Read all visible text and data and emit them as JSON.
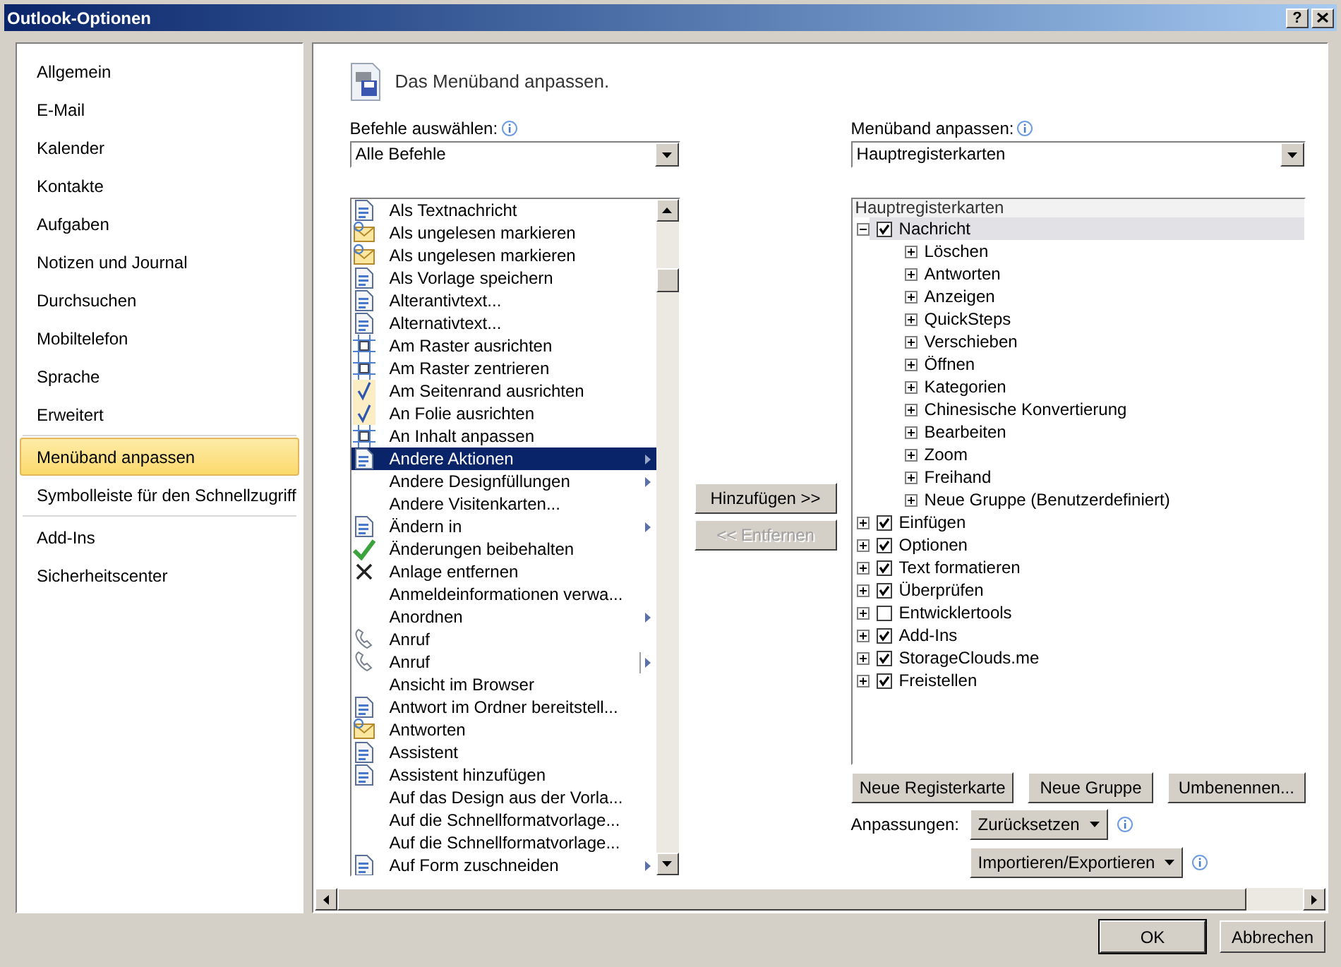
{
  "window": {
    "title": "Outlook-Optionen",
    "help_button": "?"
  },
  "sidebar": {
    "sections": [
      {
        "items": [
          {
            "label": "Allgemein",
            "selected": false
          },
          {
            "label": "E-Mail",
            "selected": false
          },
          {
            "label": "Kalender",
            "selected": false
          },
          {
            "label": "Kontakte",
            "selected": false
          },
          {
            "label": "Aufgaben",
            "selected": false
          },
          {
            "label": "Notizen und Journal",
            "selected": false
          },
          {
            "label": "Durchsuchen",
            "selected": false
          },
          {
            "label": "Mobiltelefon",
            "selected": false
          },
          {
            "label": "Sprache",
            "selected": false
          },
          {
            "label": "Erweitert",
            "selected": false
          }
        ]
      },
      {
        "items": [
          {
            "label": "Menüband anpassen",
            "selected": true
          },
          {
            "label": "Symbolleiste für den Schnellzugriff",
            "selected": false
          }
        ]
      },
      {
        "items": [
          {
            "label": "Add-Ins",
            "selected": false
          },
          {
            "label": "Sicherheitscenter",
            "selected": false
          }
        ]
      }
    ]
  },
  "heading": "Das Menüband anpassen.",
  "commands": {
    "label": "Befehle auswählen:",
    "dropdown": "Alle Befehle",
    "items": [
      {
        "label": "Als Textnachricht",
        "kind": "doc",
        "submenu": false,
        "split": false,
        "selected": false
      },
      {
        "label": "Als ungelesen markieren",
        "kind": "mail",
        "submenu": false,
        "split": false,
        "selected": false
      },
      {
        "label": "Als ungelesen markieren",
        "kind": "mail",
        "submenu": false,
        "split": false,
        "selected": false
      },
      {
        "label": "Als Vorlage speichern",
        "kind": "doc",
        "submenu": false,
        "split": false,
        "selected": false
      },
      {
        "label": "Alterantivtext...",
        "kind": "doc",
        "submenu": false,
        "split": false,
        "selected": false
      },
      {
        "label": "Alternativtext...",
        "kind": "doc",
        "submenu": false,
        "split": false,
        "selected": false
      },
      {
        "label": "Am Raster ausrichten",
        "kind": "grid",
        "submenu": false,
        "split": false,
        "selected": false
      },
      {
        "label": "Am Raster zentrieren",
        "kind": "grid",
        "submenu": false,
        "split": false,
        "selected": false
      },
      {
        "label": "Am Seitenrand ausrichten",
        "kind": "tick",
        "submenu": false,
        "split": false,
        "selected": false
      },
      {
        "label": "An Folie ausrichten",
        "kind": "tick",
        "submenu": false,
        "split": false,
        "selected": false
      },
      {
        "label": "An Inhalt anpassen",
        "kind": "grid",
        "submenu": false,
        "split": false,
        "selected": false
      },
      {
        "label": "Andere Aktionen",
        "kind": "doc",
        "submenu": true,
        "split": false,
        "selected": true
      },
      {
        "label": "Andere Designfüllungen",
        "kind": "plain",
        "submenu": true,
        "split": false,
        "selected": false
      },
      {
        "label": "Andere Visitenkarten...",
        "kind": "plain",
        "submenu": false,
        "split": false,
        "selected": false
      },
      {
        "label": "Ändern in",
        "kind": "doc",
        "submenu": true,
        "split": false,
        "selected": false
      },
      {
        "label": "Änderungen beibehalten",
        "kind": "check",
        "submenu": false,
        "split": false,
        "selected": false
      },
      {
        "label": "Anlage entfernen",
        "kind": "cross",
        "submenu": false,
        "split": false,
        "selected": false
      },
      {
        "label": "Anmeldeinformationen verwa...",
        "kind": "plain",
        "submenu": false,
        "split": false,
        "selected": false
      },
      {
        "label": "Anordnen",
        "kind": "plain",
        "submenu": true,
        "split": false,
        "selected": false
      },
      {
        "label": "Anruf",
        "kind": "phone",
        "submenu": false,
        "split": false,
        "selected": false
      },
      {
        "label": "Anruf",
        "kind": "phone",
        "submenu": true,
        "split": true,
        "selected": false
      },
      {
        "label": "Ansicht im Browser",
        "kind": "plain",
        "submenu": false,
        "split": false,
        "selected": false
      },
      {
        "label": "Antwort im Ordner bereitstell...",
        "kind": "doc",
        "submenu": false,
        "split": false,
        "selected": false
      },
      {
        "label": "Antworten",
        "kind": "mail",
        "submenu": false,
        "split": false,
        "selected": false
      },
      {
        "label": "Assistent",
        "kind": "doc",
        "submenu": false,
        "split": false,
        "selected": false
      },
      {
        "label": "Assistent hinzufügen",
        "kind": "doc",
        "submenu": false,
        "split": false,
        "selected": false
      },
      {
        "label": "Auf das Design aus der Vorla...",
        "kind": "plain",
        "submenu": false,
        "split": false,
        "selected": false
      },
      {
        "label": "Auf die Schnellformatvorlage...",
        "kind": "plain",
        "submenu": false,
        "split": false,
        "selected": false
      },
      {
        "label": "Auf die Schnellformatvorlage...",
        "kind": "plain",
        "submenu": false,
        "split": false,
        "selected": false
      },
      {
        "label": "Auf Form zuschneiden",
        "kind": "doc",
        "submenu": true,
        "split": false,
        "selected": false
      }
    ]
  },
  "add_button": {
    "label": "Hinzufügen >>",
    "disabled": false
  },
  "remove_button": {
    "label": "<< Entfernen",
    "disabled": true
  },
  "ribbon": {
    "label": "Menüband anpassen:",
    "dropdown": "Hauptregisterkarten",
    "tree": {
      "header": "Hauptregisterkarten",
      "items": [
        {
          "label": "Nachricht",
          "checked": true,
          "expanded": true,
          "selected": true,
          "children": [
            {
              "label": "Löschen",
              "expanded": false,
              "selected": false
            },
            {
              "label": "Antworten",
              "expanded": false,
              "selected": false
            },
            {
              "label": "Anzeigen",
              "expanded": false,
              "selected": false
            },
            {
              "label": "QuickSteps",
              "expanded": false,
              "selected": false
            },
            {
              "label": "Verschieben",
              "expanded": false,
              "selected": false
            },
            {
              "label": "Öffnen",
              "expanded": false,
              "selected": false
            },
            {
              "label": "Kategorien",
              "expanded": false,
              "selected": false
            },
            {
              "label": "Chinesische Konvertierung",
              "expanded": false,
              "selected": false
            },
            {
              "label": "Bearbeiten",
              "expanded": false,
              "selected": false
            },
            {
              "label": "Zoom",
              "expanded": false,
              "selected": false
            },
            {
              "label": "Freihand",
              "expanded": false,
              "selected": false
            },
            {
              "label": "Neue Gruppe (Benutzerdefiniert)",
              "expanded": false,
              "selected": false
            }
          ]
        },
        {
          "label": "Einfügen",
          "checked": true,
          "expanded": false,
          "selected": false
        },
        {
          "label": "Optionen",
          "checked": true,
          "expanded": false,
          "selected": false
        },
        {
          "label": "Text formatieren",
          "checked": true,
          "expanded": false,
          "selected": false
        },
        {
          "label": "Überprüfen",
          "checked": true,
          "expanded": false,
          "selected": false
        },
        {
          "label": "Entwicklertools",
          "checked": false,
          "expanded": false,
          "selected": false
        },
        {
          "label": "Add-Ins",
          "checked": true,
          "expanded": false,
          "selected": false
        },
        {
          "label": "StorageClouds.me",
          "checked": true,
          "expanded": false,
          "selected": false
        },
        {
          "label": "Freistellen",
          "checked": true,
          "expanded": false,
          "selected": false
        }
      ]
    },
    "buttons": [
      "Neue Registerkarte",
      "Neue Gruppe",
      "Umbenennen..."
    ],
    "customizations_label": "Anpassungen:",
    "reset_button": "Zurücksetzen",
    "import_export_button": "Importieren/Exportieren"
  },
  "dialog_buttons": [
    {
      "label": "OK",
      "default": true
    },
    {
      "label": "Abbrechen",
      "default": false
    }
  ]
}
